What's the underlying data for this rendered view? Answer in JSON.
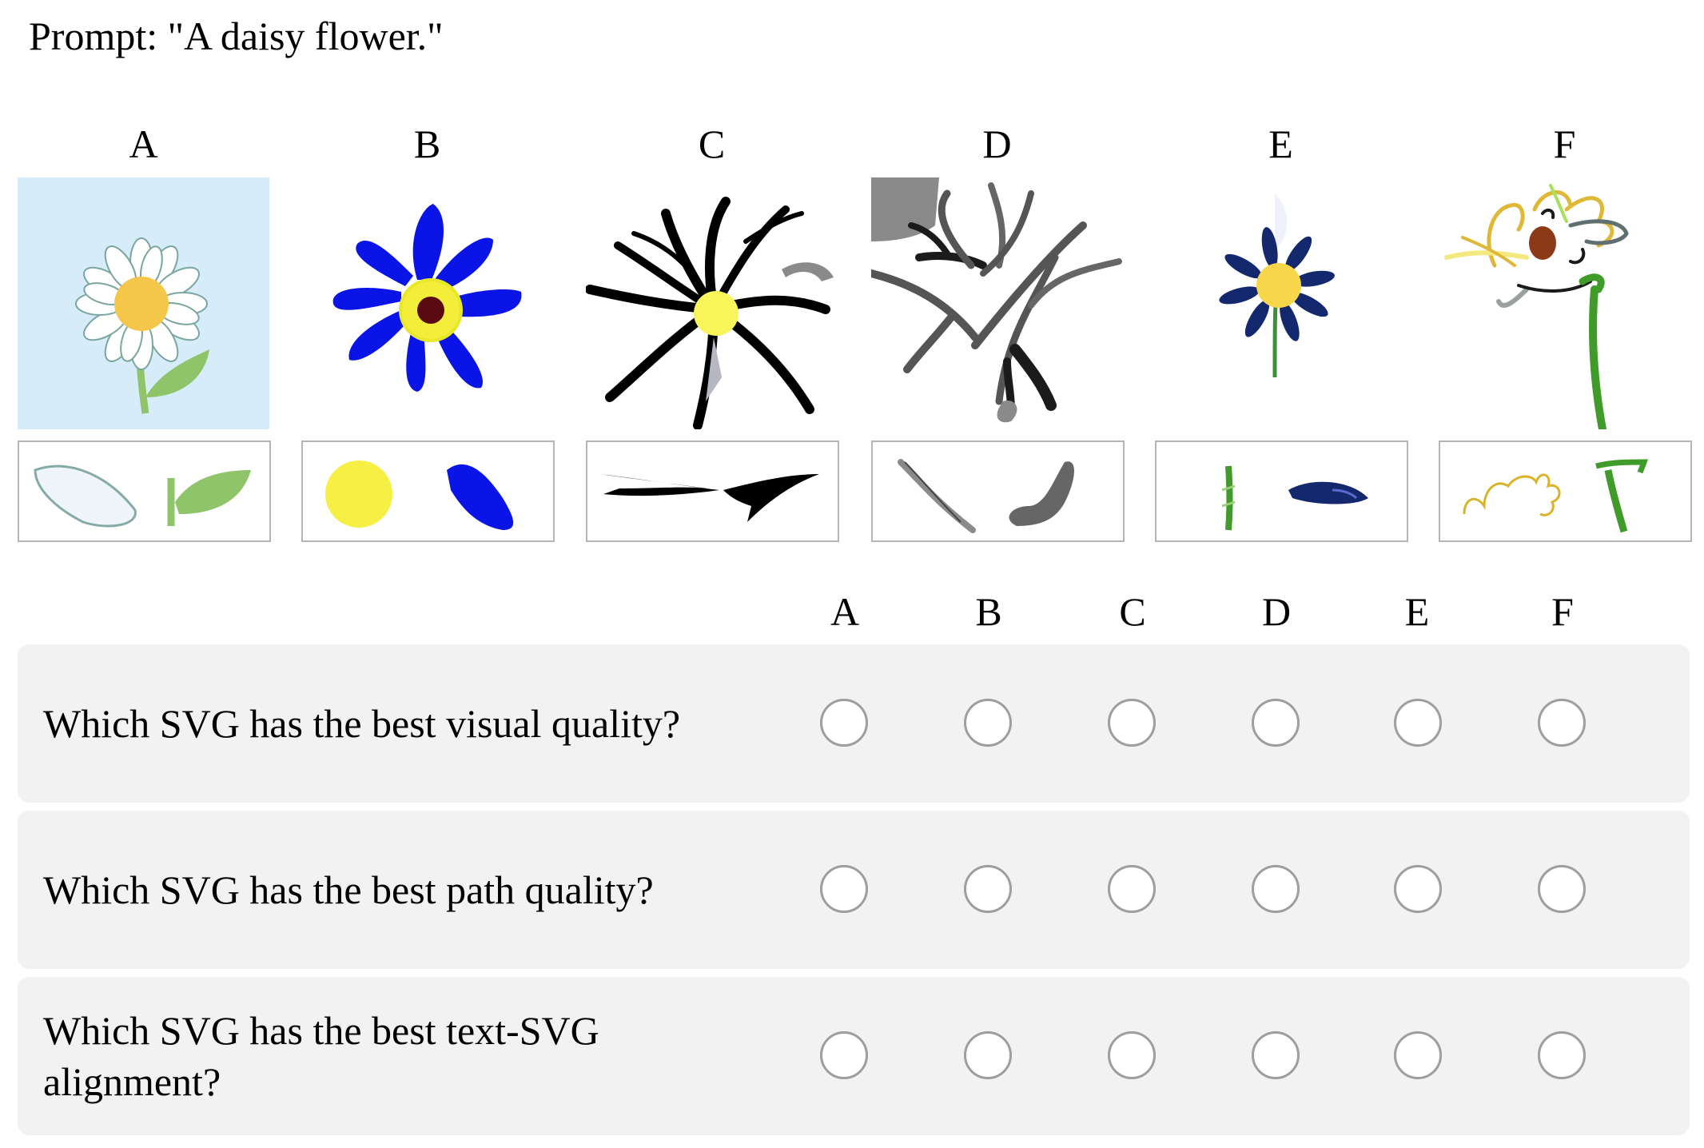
{
  "prompt": "Prompt: \"A daisy flower.\"",
  "options": [
    {
      "label": "A"
    },
    {
      "label": "B"
    },
    {
      "label": "C"
    },
    {
      "label": "D"
    },
    {
      "label": "E"
    },
    {
      "label": "F"
    }
  ],
  "questions": [
    {
      "text": "Which SVG has the best visual quality?"
    },
    {
      "text": "Which SVG has the best path quality?"
    },
    {
      "text": "Which SVG has the best text-SVG alignment?"
    }
  ],
  "colors": {
    "row_background": "#f2f2f2",
    "radio_border": "#9e9e9e",
    "part_border": "#b5b5b5"
  }
}
